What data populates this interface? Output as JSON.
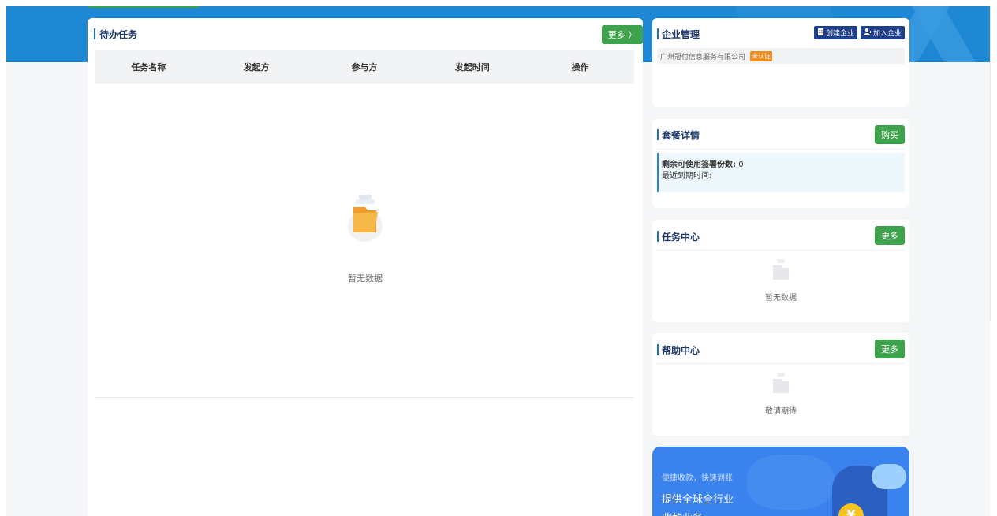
{
  "todo": {
    "title": "待办任务",
    "more_label": "更多 〉",
    "columns": [
      "任务名称",
      "发起方",
      "参与方",
      "发起时间",
      "操作"
    ],
    "empty_text": "暂无数据"
  },
  "enterprise": {
    "title": "企业管理",
    "create_label": "创建企业",
    "join_label": "加入企业",
    "company_name": "广州冠付信息服务有限公司",
    "status_badge": "未认证"
  },
  "package": {
    "title": "套餐详情",
    "buy_label": "购买",
    "remaining_label": "剩余可使用签署份数:",
    "remaining_value": "0",
    "expire_label": "最近到期时间:"
  },
  "task_center": {
    "title": "任务中心",
    "more_label": "更多",
    "empty_text": "暂无数据"
  },
  "help_center": {
    "title": "帮助中心",
    "more_label": "更多",
    "empty_text": "敬请期待"
  },
  "promo": {
    "subtitle": "便捷收款，快速到账",
    "title": "提供全球全行业",
    "title2": "收款业务",
    "coin_symbol": "¥"
  },
  "colors": {
    "brand_blue": "#1e88d4",
    "button_green": "#3fa34d",
    "enterprise_navy": "#1e3f8c",
    "badge_orange": "#f08c1c"
  },
  "icons": {
    "folder": "folder-empty-icon",
    "building": "building-icon",
    "user_add": "user-add-icon"
  }
}
